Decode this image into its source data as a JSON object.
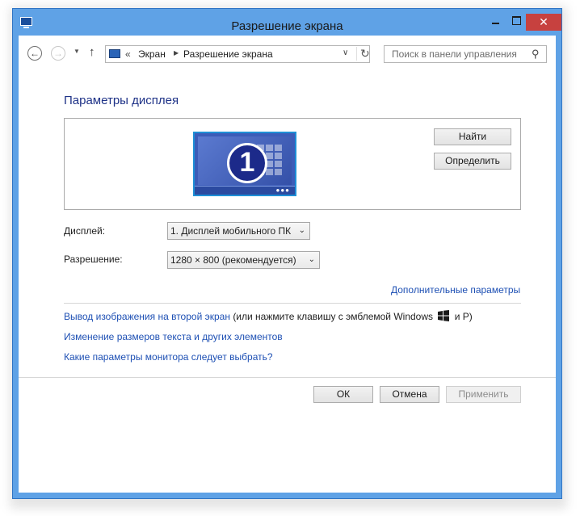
{
  "window": {
    "title": "Разрешение экрана",
    "close_glyph": "✕"
  },
  "nav": {
    "back_glyph": "←",
    "forward_glyph": "→",
    "recent_glyph": "▼",
    "up_glyph": "↑",
    "breadcrumb": {
      "overflow": "«",
      "items": [
        "Экран",
        "Разрешение экрана"
      ],
      "separator_glyph": "▶",
      "dropdown_glyph": "∨",
      "refresh_glyph": "↻"
    },
    "search": {
      "placeholder": "Поиск в панели управления",
      "icon_glyph": "⚲"
    }
  },
  "main": {
    "heading": "Параметры дисплея",
    "monitor": {
      "number": "1",
      "dots": "●●●"
    },
    "buttons": {
      "find": "Найти",
      "identify": "Определить"
    },
    "display_label": "Дисплей:",
    "display_value": "1. Дисплей мобильного ПК",
    "resolution_label": "Разрешение:",
    "resolution_value": "1280 × 800 (рекомендуется)",
    "select_arrow": "⌄",
    "advanced_link": "Дополнительные параметры",
    "links": {
      "project_link": "Вывод изображения на второй экран",
      "project_text_pre": "(или нажмите клавишу с эмблемой Windows",
      "project_text_post": "и P)",
      "resize_link": "Изменение размеров текста и других элементов",
      "which_link": "Какие параметры монитора следует выбрать?"
    }
  },
  "footer": {
    "ok": "ОК",
    "cancel": "Отмена",
    "apply": "Применить"
  },
  "icons": [
    "app-icon",
    "back-icon",
    "forward-icon",
    "up-icon",
    "control-panel-icon",
    "refresh-icon",
    "search-icon",
    "windows-logo-icon"
  ],
  "colors": {
    "title_bar": "#5fa2e6",
    "heading": "#1e3287",
    "link": "#1e50b4",
    "close_button": "#c7413f"
  }
}
